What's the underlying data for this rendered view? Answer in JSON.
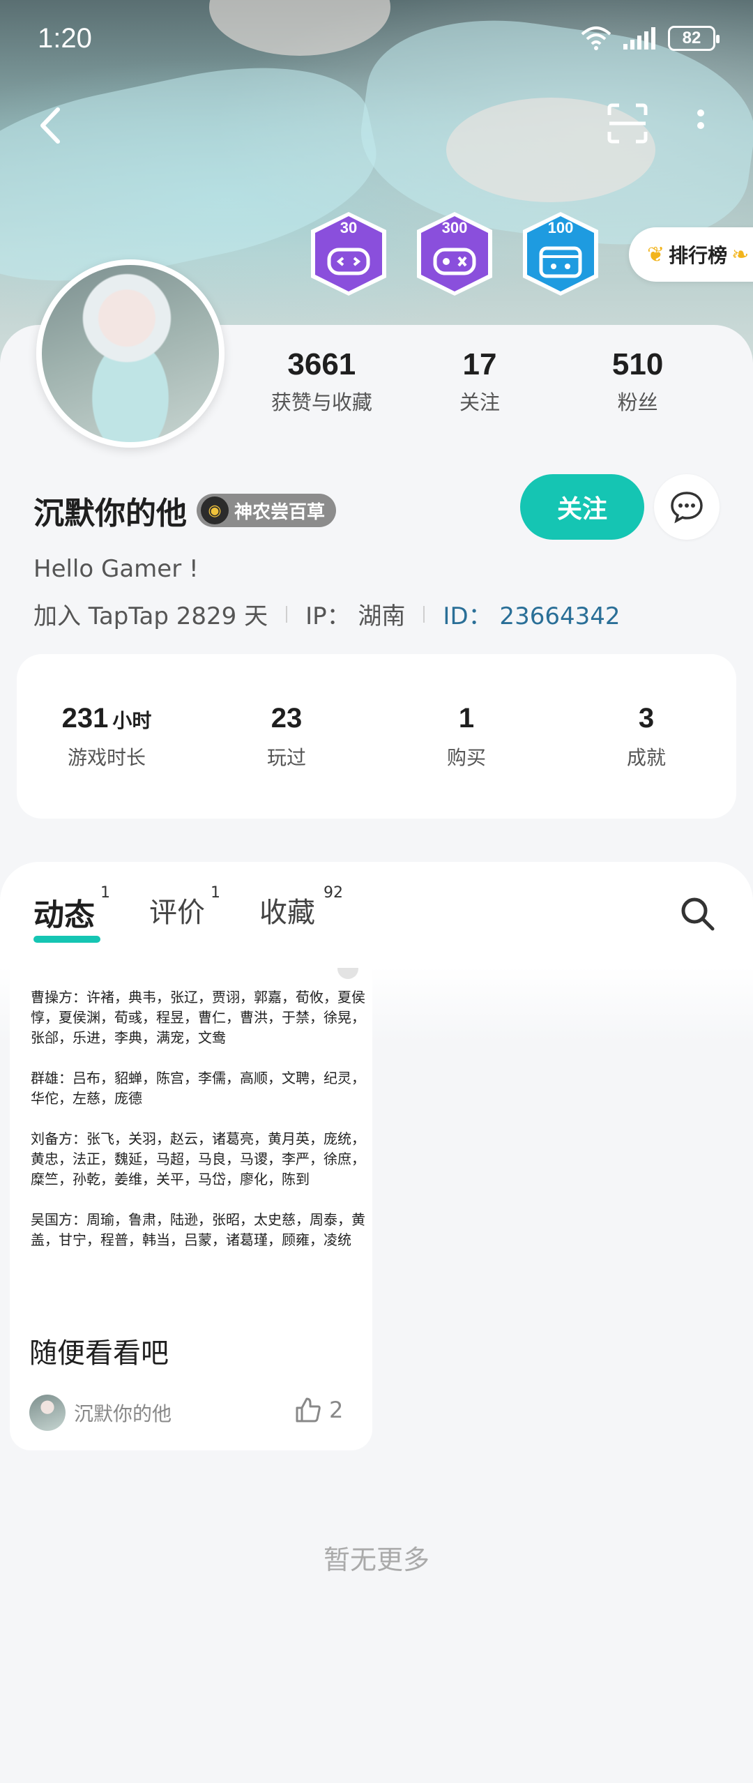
{
  "status_bar": {
    "time": "1:20",
    "battery": "82"
  },
  "badges": [
    {
      "number": "30",
      "color": "#8a4fdc"
    },
    {
      "number": "300",
      "color": "#8a4fdc"
    },
    {
      "number": "100",
      "color": "#1e9be0"
    }
  ],
  "rank_button": {
    "label": "排行榜"
  },
  "profile": {
    "stats": [
      {
        "value": "3661",
        "label": "获赞与收藏"
      },
      {
        "value": "17",
        "label": "关注"
      },
      {
        "value": "510",
        "label": "粉丝"
      }
    ],
    "name": "沉默你的他",
    "title_badge": "神农尝百草",
    "follow_label": "关注",
    "bio": "Hello Gamer !",
    "joined": "加入 TapTap 2829 天",
    "ip": "IP： 湖南",
    "id": "ID： 23664342"
  },
  "game_stats": [
    {
      "value": "231",
      "unit": "小时",
      "label": "游戏时长"
    },
    {
      "value": "23",
      "unit": "",
      "label": "玩过"
    },
    {
      "value": "1",
      "unit": "",
      "label": "购买"
    },
    {
      "value": "3",
      "unit": "",
      "label": "成就"
    }
  ],
  "tabs": [
    {
      "label": "动态",
      "count": "1"
    },
    {
      "label": "评价",
      "count": "1"
    },
    {
      "label": "收藏",
      "count": "92"
    }
  ],
  "post": {
    "image_paragraphs": [
      "曹操方：许褚，典韦，张辽，贾诩，郭嘉，荀攸，夏侯惇，夏侯渊，荀彧，程昱，曹仁，曹洪，于禁，徐晃，张郃，乐进，李典，满宠，文鸯",
      "群雄：吕布，貂蝉，陈宫，李儒，高顺，文聘，纪灵，华佗，左慈，庞德",
      "刘备方：张飞，关羽，赵云，诸葛亮，黄月英，庞统，黄忠，法正，魏延，马超，马良，马谡，李严，徐庶，糜竺，孙乾，姜维，关平，马岱，廖化，陈到",
      "吴国方：周瑜，鲁肃，陆逊，张昭，太史慈，周泰，黄盖，甘宁，程普，韩当，吕蒙，诸葛瑾，顾雍，凌统"
    ],
    "title": "随便看看吧",
    "author": "沉默你的他",
    "likes": "2"
  },
  "footer": {
    "no_more": "暂无更多"
  },
  "colors": {
    "accent": "#15c5b3",
    "id_blue": "#2a6f97"
  }
}
